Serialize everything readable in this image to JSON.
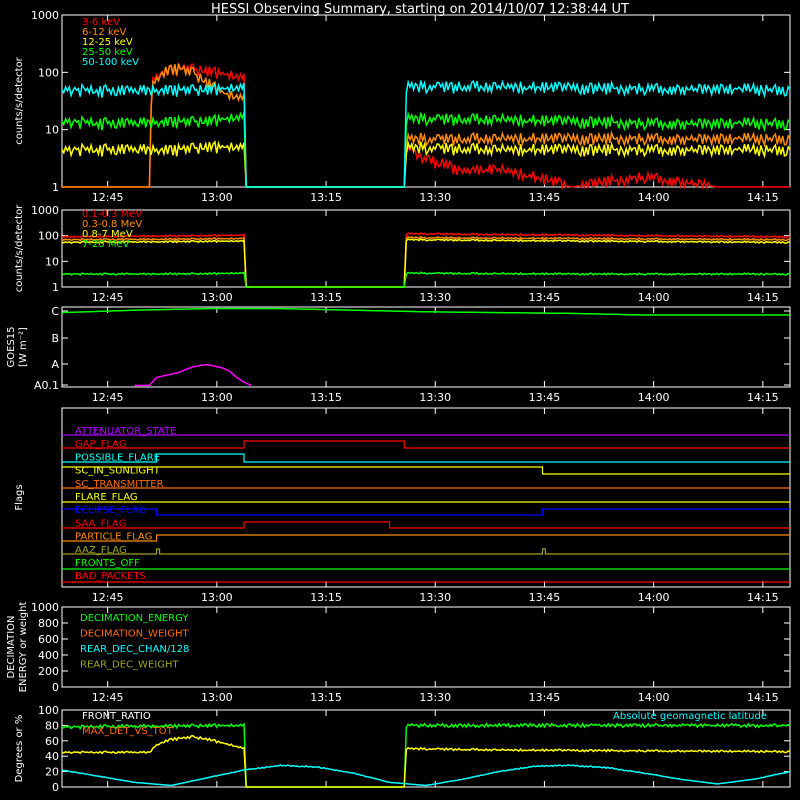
{
  "title": "HESSI Observing Summary, starting on 2014/10/07 12:38:44 UT",
  "time_ticks": [
    "12:45",
    "13:00",
    "13:15",
    "13:30",
    "13:45",
    "14:00",
    "14:15"
  ],
  "colors": {
    "red": "#ff0000",
    "orange": "#ff8c00",
    "yellow": "#ffff00",
    "green": "#00ff00",
    "cyan": "#00ffff",
    "magenta": "#ff00ff",
    "blue": "#0000ff",
    "purple": "#b000ff",
    "olive": "#a0a020",
    "darkorange": "#ff6a00",
    "white": "#ffffff"
  },
  "panels": [
    {
      "id": "lightcurves",
      "ylabel": "counts/s/detector",
      "yticks": [
        "1",
        "10",
        "100",
        "1000"
      ],
      "legend": [
        {
          "label": "3-6 keV",
          "color": "red"
        },
        {
          "label": "6-12 keV",
          "color": "orange"
        },
        {
          "label": "12-25 keV",
          "color": "yellow"
        },
        {
          "label": "25-50 keV",
          "color": "green"
        },
        {
          "label": "50-100 keV",
          "color": "cyan"
        }
      ]
    },
    {
      "id": "high-energy",
      "ylabel": "counts/s/detector",
      "yticks": [
        "1",
        "10",
        "100",
        "1000"
      ],
      "legend": [
        {
          "label": "0.1-0.3 MeV",
          "color": "red"
        },
        {
          "label": "0.3-0.8 MeV",
          "color": "orange"
        },
        {
          "label": "0.8-7 MeV",
          "color": "yellow"
        },
        {
          "label": "7-20 MeV",
          "color": "green"
        }
      ]
    },
    {
      "id": "goes",
      "ylabel": "GOES15 [W m⁻²]",
      "yticks": [
        "A0.1",
        "A",
        "B",
        "C"
      ]
    },
    {
      "id": "flags",
      "ylabel": "Flags",
      "flags": [
        {
          "label": "ATTENUATOR_STATE",
          "color": "purple"
        },
        {
          "label": "GAP_FLAG",
          "color": "red"
        },
        {
          "label": "POSSIBLE_FLARE",
          "color": "cyan"
        },
        {
          "label": "SC_IN_SUNLIGHT",
          "color": "yellow"
        },
        {
          "label": "SC_TRANSMITTER",
          "color": "darkorange"
        },
        {
          "label": "FLARE_FLAG",
          "color": "yellow"
        },
        {
          "label": "ECLIPSE_FLAG",
          "color": "blue"
        },
        {
          "label": "SAA_FLAG",
          "color": "red"
        },
        {
          "label": "PARTICLE_FLAG",
          "color": "orange"
        },
        {
          "label": "AAZ_FLAG",
          "color": "olive"
        },
        {
          "label": "FRONTS_OFF",
          "color": "green"
        },
        {
          "label": "BAD_PACKETS",
          "color": "red"
        }
      ]
    },
    {
      "id": "decimation",
      "ylabel": "DECIMATION ENERGY or weight",
      "yticks": [
        "0",
        "200",
        "400",
        "600",
        "800",
        "1000"
      ],
      "legend": [
        {
          "label": "DECIMATION_ENERGY",
          "color": "green"
        },
        {
          "label": "DECIMATION_WEIGHT",
          "color": "darkorange"
        },
        {
          "label": "REAR_DEC_CHAN/128",
          "color": "cyan"
        },
        {
          "label": "REAR_DEC_WEIGHT",
          "color": "olive"
        }
      ]
    },
    {
      "id": "ratios",
      "ylabel": "Degrees or %",
      "yticks": [
        "0",
        "20",
        "40",
        "60",
        "80",
        "100"
      ],
      "legend": [
        {
          "label": "FRONT_RATIO",
          "color": "white"
        },
        {
          "label": "MAX_DET_VS_TOT",
          "color": "darkorange"
        }
      ],
      "right_label": {
        "label": "Absolute geomagnetic latitude",
        "color": "cyan"
      }
    }
  ],
  "chart_data": [
    {
      "type": "line",
      "title": "HESSI Observing Summary, starting on 2014/10/07 12:38:44 UT",
      "ylabel": "counts/s/detector",
      "yscale": "log",
      "ylim": [
        1,
        1000
      ],
      "x_unit": "minutes after 12:38:44 UT",
      "xlim": [
        0,
        100
      ],
      "series": [
        {
          "name": "3-6 keV",
          "color": "red",
          "x": [
            0,
            12,
            12.5,
            13,
            14,
            15,
            16,
            17,
            18,
            19,
            20,
            21,
            22,
            23,
            24,
            25,
            25.3,
            47,
            47.3,
            50,
            55,
            60,
            70,
            80,
            90,
            100
          ],
          "y": [
            1,
            1,
            70,
            90,
            100,
            110,
            115,
            120,
            115,
            110,
            105,
            100,
            95,
            90,
            85,
            80,
            1,
            1,
            5,
            3,
            2,
            2,
            1,
            1.5,
            1,
            1
          ]
        },
        {
          "name": "6-12 keV",
          "color": "orange",
          "x": [
            0,
            12,
            12.5,
            13,
            14,
            15,
            16,
            17,
            18,
            19,
            20,
            21,
            22,
            23,
            24,
            25,
            25.3,
            47,
            47.3,
            60,
            70,
            80,
            90,
            100
          ],
          "y": [
            1,
            1,
            60,
            80,
            100,
            115,
            120,
            110,
            100,
            80,
            65,
            55,
            45,
            40,
            38,
            35,
            1,
            1,
            7,
            7,
            7,
            7,
            7,
            7
          ]
        },
        {
          "name": "12-25 keV",
          "color": "yellow",
          "x": [
            0,
            5,
            10,
            15,
            20,
            25,
            25.3,
            47,
            47.3,
            60,
            70,
            80,
            90,
            100
          ],
          "y": [
            4.5,
            4.5,
            4.5,
            4.5,
            5,
            5,
            1,
            1,
            5,
            4.5,
            4.5,
            4.5,
            4.5,
            4.5
          ]
        },
        {
          "name": "25-50 keV",
          "color": "green",
          "x": [
            0,
            5,
            10,
            15,
            20,
            25,
            25.3,
            47,
            47.3,
            60,
            70,
            80,
            90,
            100
          ],
          "y": [
            14,
            13,
            13,
            14,
            14,
            17,
            1,
            1,
            16,
            15,
            14,
            13,
            13,
            13
          ]
        },
        {
          "name": "50-100 keV",
          "color": "cyan",
          "x": [
            0,
            5,
            10,
            15,
            20,
            25,
            25.3,
            47,
            47.3,
            60,
            70,
            80,
            90,
            100
          ],
          "y": [
            50,
            48,
            48,
            50,
            50,
            55,
            1,
            1,
            58,
            56,
            54,
            52,
            52,
            50
          ]
        }
      ]
    },
    {
      "type": "line",
      "ylabel": "counts/s/detector",
      "yscale": "log",
      "ylim": [
        1,
        1000
      ],
      "x_unit": "minutes after 12:38:44 UT",
      "xlim": [
        0,
        100
      ],
      "series": [
        {
          "name": "0.1-0.3 MeV",
          "color": "red",
          "x": [
            0,
            10,
            20,
            25,
            25.3,
            47,
            47.3,
            60,
            70,
            80,
            90,
            100
          ],
          "y": [
            90,
            95,
            100,
            105,
            1,
            1,
            120,
            110,
            105,
            100,
            95,
            90
          ]
        },
        {
          "name": "0.3-0.8 MeV",
          "color": "orange",
          "x": [
            0,
            10,
            20,
            25,
            25.3,
            47,
            47.3,
            60,
            70,
            80,
            90,
            100
          ],
          "y": [
            70,
            72,
            75,
            78,
            1,
            1,
            85,
            80,
            78,
            75,
            72,
            70
          ]
        },
        {
          "name": "0.8-7 MeV",
          "color": "yellow",
          "x": [
            0,
            10,
            20,
            25,
            25.3,
            47,
            47.3,
            60,
            70,
            80,
            90,
            100
          ],
          "y": [
            55,
            57,
            60,
            62,
            1,
            1,
            70,
            65,
            62,
            60,
            57,
            55
          ]
        },
        {
          "name": "7-20 MeV",
          "color": "green",
          "x": [
            0,
            10,
            20,
            25,
            25.3,
            47,
            47.3,
            60,
            70,
            80,
            90,
            100
          ],
          "y": [
            3.2,
            3.2,
            3.3,
            3.5,
            1,
            1,
            3.5,
            3.3,
            3.2,
            3.2,
            3.2,
            3.2
          ]
        }
      ]
    },
    {
      "type": "line",
      "ylabel": "GOES15 [W m⁻²]",
      "ylim": [
        "A0.1",
        "C"
      ],
      "x_unit": "minutes after 12:38:44 UT",
      "xlim": [
        0,
        100
      ],
      "series": [
        {
          "color": "green",
          "x": [
            0,
            10,
            20,
            30,
            40,
            50,
            60,
            70,
            80,
            90,
            100
          ],
          "y": [
            0.93,
            0.96,
            0.98,
            0.98,
            0.96,
            0.94,
            0.93,
            0.92,
            0.9,
            0.9,
            0.9
          ]
        },
        {
          "color": "magenta",
          "x": [
            10,
            12,
            13,
            14,
            16,
            17,
            18,
            19,
            20,
            21,
            22,
            23,
            24,
            25,
            26
          ],
          "y": [
            0.02,
            0.02,
            0.12,
            0.14,
            0.18,
            0.22,
            0.25,
            0.27,
            0.28,
            0.26,
            0.24,
            0.2,
            0.12,
            0.06,
            0.02
          ]
        }
      ]
    },
    {
      "type": "line",
      "ylabel": "Degrees or %",
      "ylim": [
        0,
        100
      ],
      "x_unit": "minutes after 12:38:44 UT",
      "xlim": [
        0,
        100
      ],
      "series": [
        {
          "name": "FRONT_RATIO",
          "color": "green",
          "x": [
            0,
            25,
            25.3,
            47,
            47.3,
            100
          ],
          "y": [
            78,
            80,
            0,
            0,
            80,
            80
          ]
        },
        {
          "name": "MAX_DET_VS_TOT",
          "color": "yellow",
          "x": [
            0,
            12,
            13,
            15,
            18,
            20,
            23,
            25,
            25.3,
            47,
            47.3,
            60,
            80,
            100
          ],
          "y": [
            45,
            45,
            55,
            62,
            65,
            62,
            55,
            50,
            0,
            0,
            50,
            48,
            47,
            46
          ]
        },
        {
          "name": "Absolute geomagnetic latitude",
          "color": "cyan",
          "x": [
            0,
            5,
            10,
            15,
            20,
            25,
            30,
            35,
            40,
            45,
            50,
            55,
            60,
            65,
            70,
            75,
            80,
            85,
            90,
            95,
            100
          ],
          "y": [
            22,
            14,
            6,
            2,
            12,
            22,
            28,
            26,
            18,
            6,
            2,
            10,
            20,
            27,
            28,
            25,
            18,
            10,
            4,
            10,
            20
          ]
        }
      ]
    }
  ]
}
